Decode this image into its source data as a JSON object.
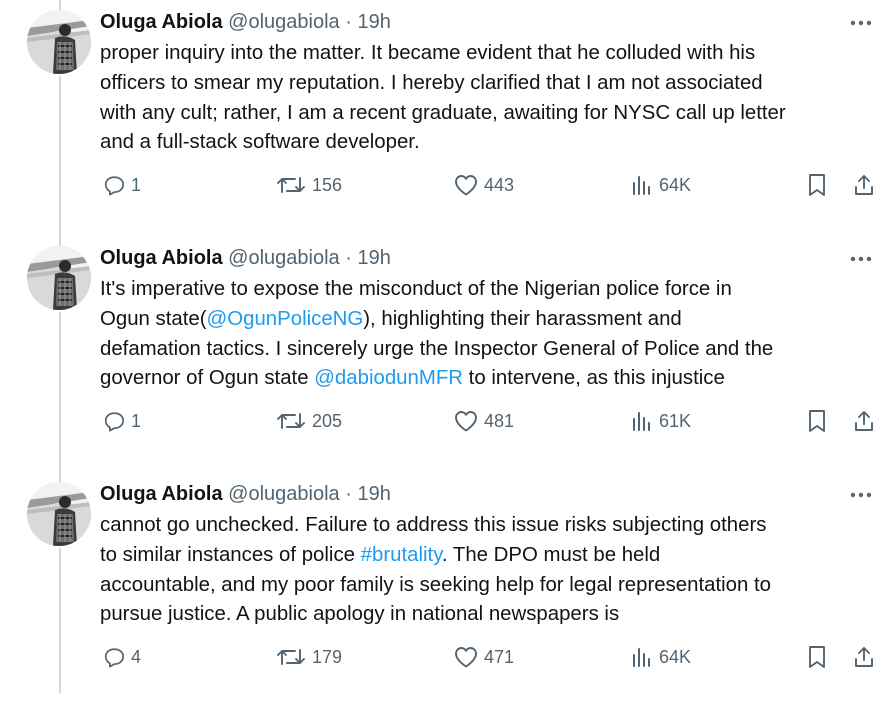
{
  "tweets": [
    {
      "author": {
        "name": "Oluga Abiola",
        "handle": "@olugabiola"
      },
      "separator": "·",
      "time": "19h",
      "lines": [
        {
          "text": "proper inquiry into the matter. It became evident that he colluded with his"
        },
        {
          "text": "officers to smear my reputation. I hereby clarified that I am not associated"
        },
        {
          "text": "with any cult; rather, I am a recent graduate, awaiting for NYSC call up letter"
        },
        {
          "text": "and a  full-stack software developer."
        }
      ],
      "stats": {
        "replies": "1",
        "reposts": "156",
        "likes": "443",
        "views": "64K"
      }
    },
    {
      "author": {
        "name": "Oluga Abiola",
        "handle": "@olugabiola"
      },
      "separator": "·",
      "time": "19h",
      "lines": [
        {
          "text": "It's imperative to expose the misconduct of the Nigerian police force in"
        },
        {
          "pre": "Ogun state(",
          "link": "@OgunPoliceNG",
          "post": "), highlighting their harassment and"
        },
        {
          "text": "defamation tactics. I sincerely urge the Inspector General of Police and the"
        },
        {
          "pre": "governor of Ogun state ",
          "link": "@dabiodunMFR",
          "post": " to intervene, as this injustice"
        }
      ],
      "stats": {
        "replies": "1",
        "reposts": "205",
        "likes": "481",
        "views": "61K"
      }
    },
    {
      "author": {
        "name": "Oluga Abiola",
        "handle": "@olugabiola"
      },
      "separator": "·",
      "time": "19h",
      "lines": [
        {
          "text": "cannot go unchecked. Failure to address this issue risks subjecting others"
        },
        {
          "pre": "to similar instances of police ",
          "link": "#brutality",
          "post": ". The DPO must be held"
        },
        {
          "text": "accountable, and my poor family is seeking help for legal representation to"
        },
        {
          "text": "pursue justice. A public apology in national newspapers is"
        }
      ],
      "stats": {
        "replies": "4",
        "reposts": "179",
        "likes": "471",
        "views": "64K"
      }
    }
  ],
  "icons": {
    "more": "more-dots-icon",
    "reply": "reply-bubble-icon",
    "repost": "repost-icon",
    "like": "heart-icon",
    "views": "views-bars-icon",
    "bookmark": "bookmark-icon",
    "share": "share-upload-icon"
  },
  "colors": {
    "text": "#0f1419",
    "secondary": "#536471",
    "link": "#1d9bf0",
    "thread_line": "#cfd9de"
  }
}
